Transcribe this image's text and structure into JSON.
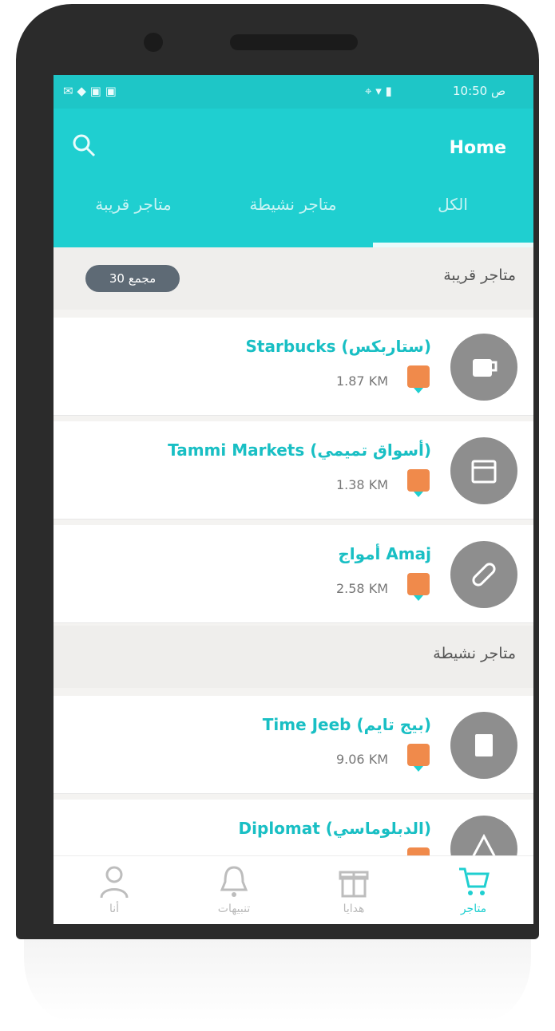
{
  "status_bar": {
    "time": "10:50 ص"
  },
  "toolbar": {
    "title": "Home"
  },
  "tabs": [
    {
      "label": "الكل"
    },
    {
      "label": "متاجر نشيطة"
    },
    {
      "label": "متاجر قريبة"
    }
  ],
  "sections": {
    "nearby": {
      "title": "متاجر قريبة",
      "badge": "مجمع 30"
    },
    "active": {
      "title": "متاجر نشيطة"
    }
  },
  "stores": [
    {
      "name": "Starbucks (ستاربكس)",
      "distance": "1.87 KM",
      "icon": "cup-icon"
    },
    {
      "name": "Tammi Markets (أسواق تميمي)",
      "distance": "1.38 KM",
      "icon": "cart-icon"
    },
    {
      "name": "أمواج Amaj",
      "distance": "2.58 KM",
      "icon": "link-icon"
    },
    {
      "name": "Time Jeeb (بيج تايم)",
      "distance": "9.06 KM",
      "icon": "box-icon"
    },
    {
      "name": "Diplomat (الدبلوماسي)",
      "distance": "",
      "icon": "tent-icon"
    }
  ],
  "bottom_nav": [
    {
      "label": "متاجر",
      "icon": "cart-icon",
      "active": true
    },
    {
      "label": "هدايا",
      "icon": "gift-icon",
      "active": false
    },
    {
      "label": "تنبيهات",
      "icon": "bell-icon",
      "active": false
    },
    {
      "label": "أنا",
      "icon": "user-icon",
      "active": false
    }
  ],
  "colors": {
    "primary": "#1fcfd0",
    "badge": "#5e6a75",
    "marker": "#f08a4b"
  }
}
